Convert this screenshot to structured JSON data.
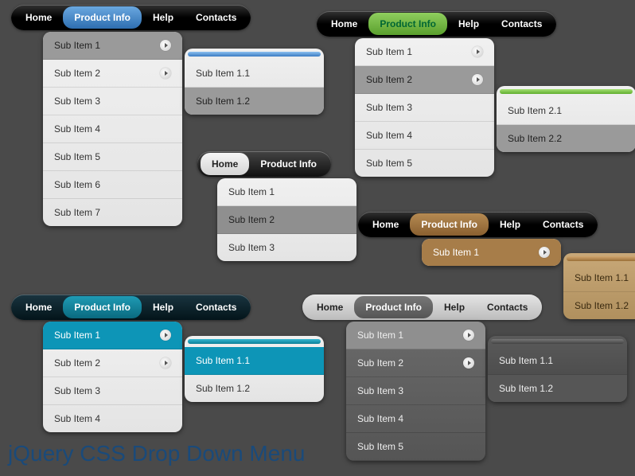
{
  "nav": {
    "home": "Home",
    "product_info": "Product Info",
    "help": "Help",
    "contacts": "Contacts"
  },
  "sub": {
    "i1": "Sub Item 1",
    "i2": "Sub Item 2",
    "i3": "Sub Item 3",
    "i4": "Sub Item 4",
    "i5": "Sub Item 5",
    "i6": "Sub Item 6",
    "i7": "Sub Item 7",
    "s11": "Sub Item 1.1",
    "s12": "Sub Item 1.2",
    "s21": "Sub Item 2.1",
    "s22": "Sub Item 2.2"
  },
  "footer": "jQuery CSS Drop Down Menu",
  "themes": {
    "blue": "#3b7bc2",
    "green": "#5aa02d",
    "teal": "#0d95b7",
    "brown": "#a77d49",
    "grey": "#888888"
  }
}
